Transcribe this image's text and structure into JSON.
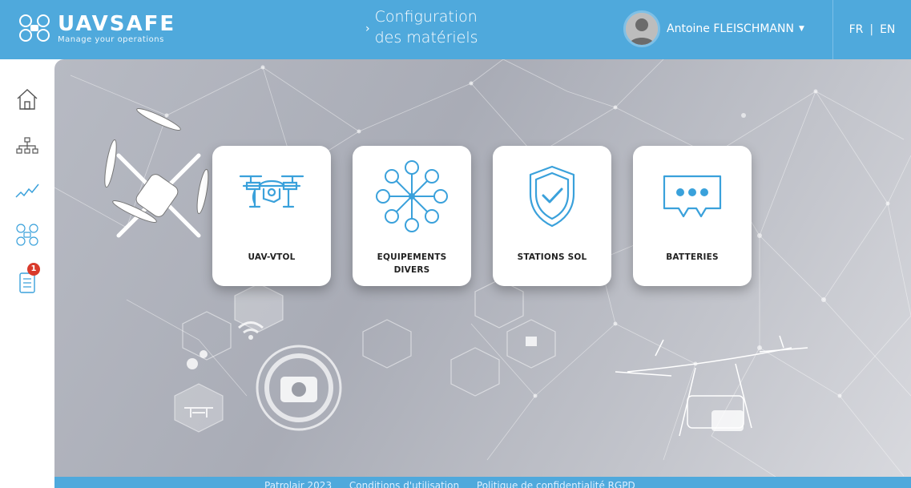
{
  "header": {
    "logo_title": "UAVSAFE",
    "logo_tagline": "Manage your operations",
    "page_title_line1": "Configuration",
    "page_title_line2": "des matériels",
    "user_name": "Antoine FLEISCHMANN",
    "lang_fr": "FR",
    "lang_sep": "|",
    "lang_en": "EN"
  },
  "sidebar": {
    "items": [
      {
        "icon": "home-icon"
      },
      {
        "icon": "org-chart-icon"
      },
      {
        "icon": "analytics-icon"
      },
      {
        "icon": "drone-icon"
      },
      {
        "icon": "checklist-icon",
        "badge": "1"
      }
    ]
  },
  "cards": [
    {
      "label": "UAV-VTOL",
      "icon": "drone-icon"
    },
    {
      "label_line1": "EQUIPEMENTS",
      "label_line2": "DIVERS",
      "icon": "network-icon"
    },
    {
      "label": "STATIONS SOL",
      "icon": "shield-check-icon"
    },
    {
      "label": "BATTERIES",
      "icon": "chat-bubble-icon"
    }
  ],
  "footer": {
    "copyright": "Patrolair 2023",
    "terms": "Conditions d'utilisation",
    "privacy": "Politique de confidentialité RGPD"
  },
  "colors": {
    "header_bg": "#4fa9dc",
    "icon_blue": "#3aa1db",
    "badge_red": "#d93a2b"
  }
}
